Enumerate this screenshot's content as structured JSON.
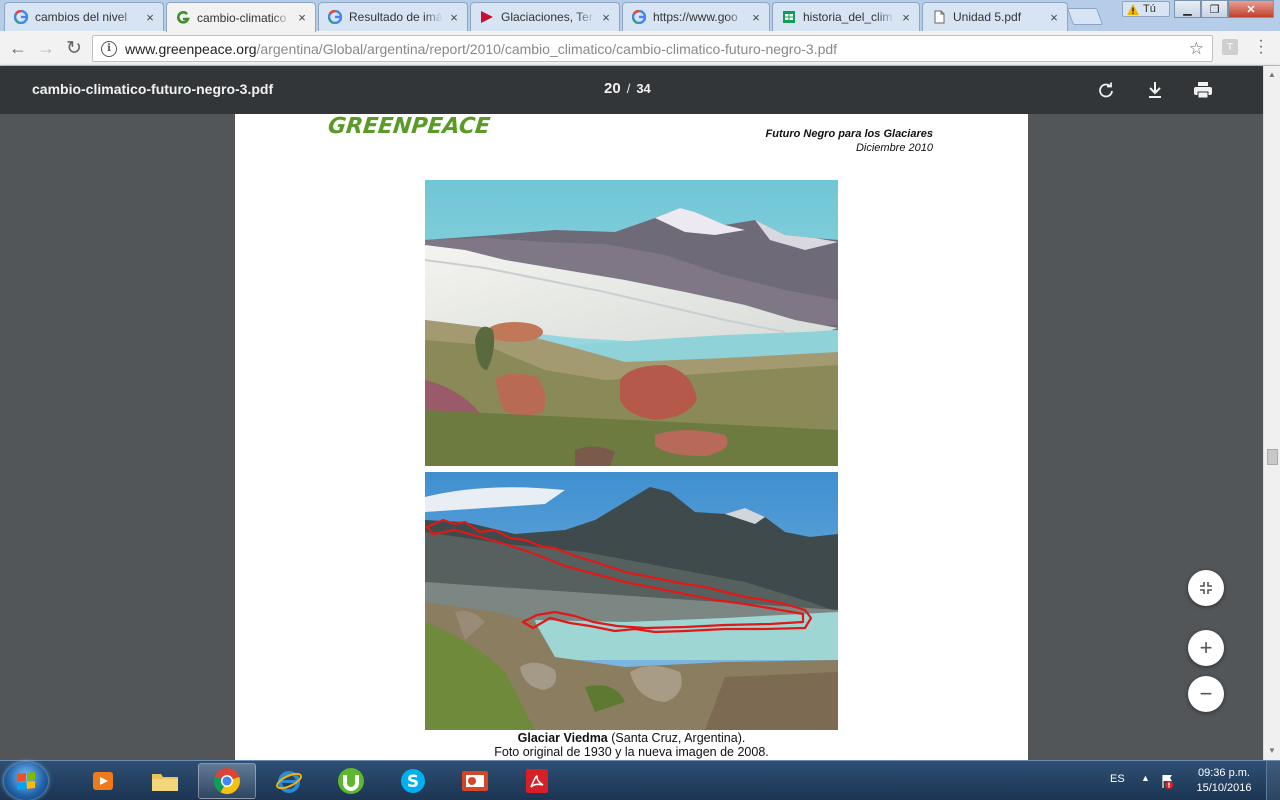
{
  "browser": {
    "tabs": [
      {
        "title": "cambios del nivel",
        "icon": "google-icon",
        "active": false
      },
      {
        "title": "cambio-climatico",
        "icon": "greenpeace-icon",
        "active": true
      },
      {
        "title": "Resultado de imá",
        "icon": "google-icon",
        "active": false
      },
      {
        "title": "Glaciaciones, Ter",
        "icon": "youtube-like-icon",
        "active": false
      },
      {
        "title": "https://www.goo",
        "icon": "google-icon",
        "active": false
      },
      {
        "title": "historia_del_clim",
        "icon": "sheets-icon",
        "active": false
      },
      {
        "title": "Unidad 5.pdf",
        "icon": "document-icon",
        "active": false
      }
    ],
    "tab_close": "×",
    "profile_label": "Tú",
    "window_controls": {
      "minimize": "▁",
      "maximize": "❐",
      "close": "✕"
    },
    "address": {
      "host": "www.greenpeace.org",
      "path": "/argentina/Global/argentina/report/2010/cambio_climatico/cambio-climatico-futuro-negro-3.pdf",
      "info_glyph": "i",
      "star_glyph": "☆"
    },
    "extension_letter": "T",
    "nav": {
      "back": "←",
      "forward": "→",
      "reload": "↻"
    }
  },
  "pdf_viewer": {
    "filename": "cambio-climatico-futuro-negro-3.pdf",
    "current_page": "20",
    "page_separator": "/",
    "total_pages": "34",
    "zoom": {
      "fit": "⤡",
      "in": "+",
      "out": "−"
    }
  },
  "document": {
    "logo_text": "GREENPEACE",
    "header_title": "Futuro Negro para los Glaciares",
    "header_date": "Diciembre 2010",
    "caption_bold": "Glaciar Viedma",
    "caption_rest": " (Santa Cruz, Argentina).",
    "caption_line2": "Foto original de 1930 y la nueva imagen de 2008."
  },
  "taskbar": {
    "pinned": [
      {
        "name": "media-player",
        "open": false
      },
      {
        "name": "file-explorer",
        "open": false
      },
      {
        "name": "chrome",
        "open": true
      },
      {
        "name": "internet-explorer",
        "open": false
      },
      {
        "name": "utorrent",
        "open": false
      },
      {
        "name": "skype",
        "open": false
      },
      {
        "name": "powerpoint",
        "open": false
      },
      {
        "name": "acrobat",
        "open": false
      }
    ],
    "language": "ES",
    "tray_arrow": "▲",
    "time": "09:36 p.m.",
    "date": "15/10/2016"
  },
  "colors": {
    "pdf_toolbar": "#323639",
    "viewer_bg": "#525659",
    "greenpeace_green": "#5a9a26",
    "outline_red": "#e01818"
  }
}
